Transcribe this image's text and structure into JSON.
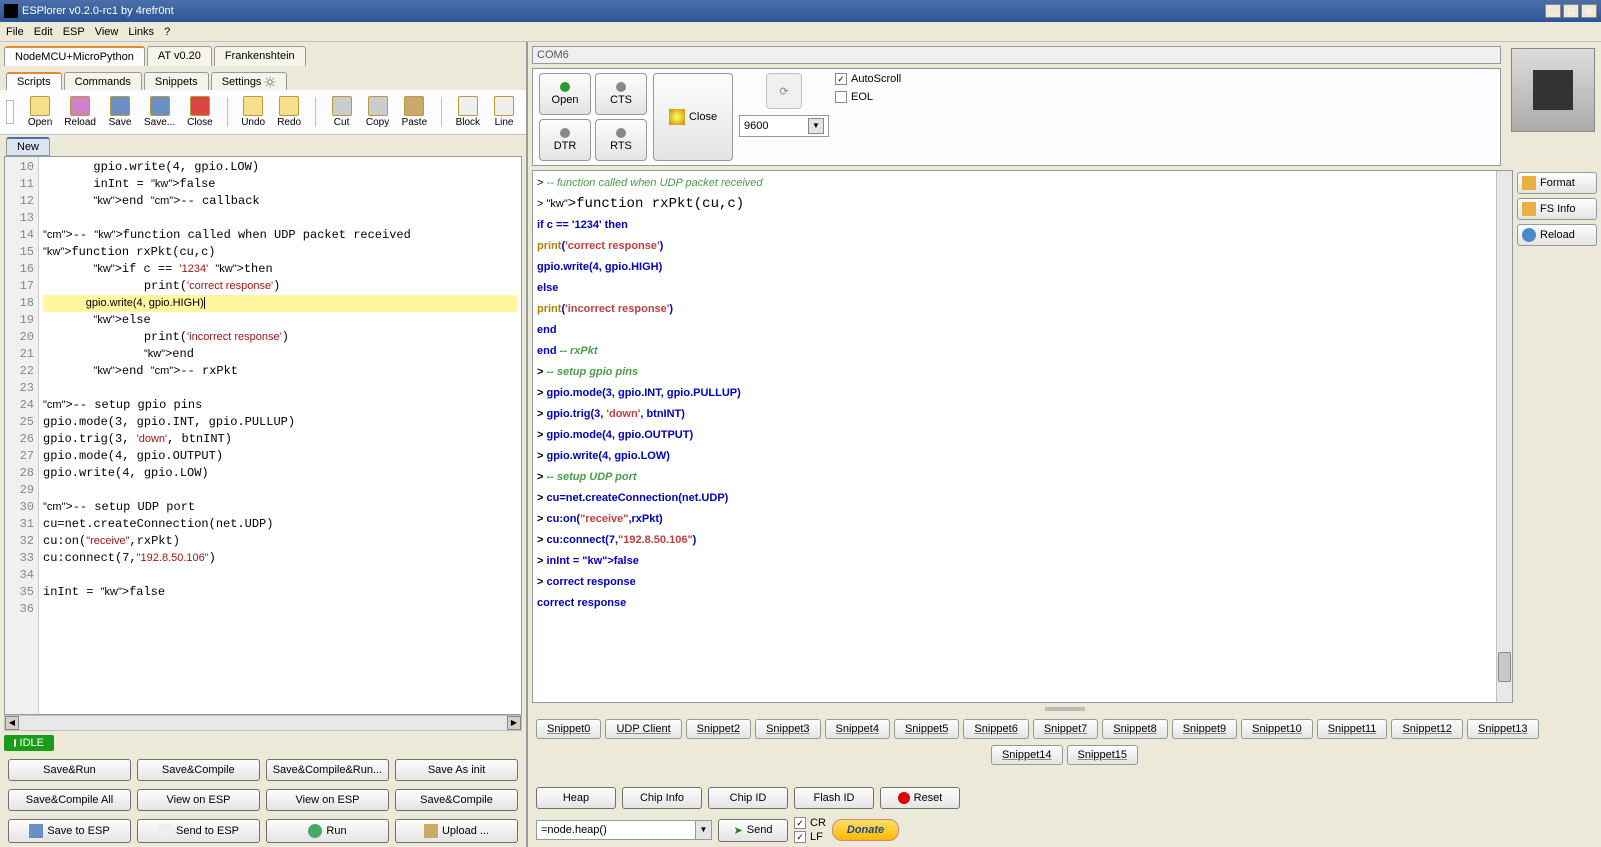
{
  "title": "ESPlorer v0.2.0-rc1 by 4refr0nt",
  "menubar": [
    "File",
    "Edit",
    "ESP",
    "View",
    "Links",
    "?"
  ],
  "left": {
    "top_tabs": [
      "NodeMCU+MicroPython",
      "AT v0.20",
      "Frankenshtein"
    ],
    "sub_tabs": [
      "Scripts",
      "Commands",
      "Snippets",
      "Settings"
    ],
    "toolbar": [
      "Open",
      "Reload",
      "Save",
      "Save...",
      "Close",
      "Undo",
      "Redo",
      "Cut",
      "Copy",
      "Paste",
      "Block",
      "Line"
    ],
    "file_tab": "New",
    "idle": "IDLE",
    "buttons_row1": [
      "Save&Run",
      "Save&Compile",
      "Save&Compile&Run...",
      "Save As init"
    ],
    "buttons_row2": [
      "Save&Compile All",
      "View on ESP",
      "View on ESP",
      "Save&Compile"
    ],
    "buttons_row3": [
      "Save to ESP",
      "Send to ESP",
      "Run",
      "Upload ..."
    ],
    "code_lines": [
      {
        "n": 10,
        "raw": "       gpio.write(4, gpio.LOW)"
      },
      {
        "n": 11,
        "raw": "       inInt = false"
      },
      {
        "n": 12,
        "raw": "       end -- callback"
      },
      {
        "n": 13,
        "raw": ""
      },
      {
        "n": 14,
        "raw": "-- function called when UDP packet received"
      },
      {
        "n": 15,
        "raw": "function rxPkt(cu,c)"
      },
      {
        "n": 16,
        "raw": "       if c == '1234' then"
      },
      {
        "n": 17,
        "raw": "              print('correct response')"
      },
      {
        "n": 18,
        "raw": "              gpio.write(4, gpio.HIGH)",
        "hl": true
      },
      {
        "n": 19,
        "raw": "       else"
      },
      {
        "n": 20,
        "raw": "              print('incorrect response')"
      },
      {
        "n": 21,
        "raw": "              end"
      },
      {
        "n": 22,
        "raw": "       end -- rxPkt"
      },
      {
        "n": 23,
        "raw": ""
      },
      {
        "n": 24,
        "raw": "-- setup gpio pins"
      },
      {
        "n": 25,
        "raw": "gpio.mode(3, gpio.INT, gpio.PULLUP)"
      },
      {
        "n": 26,
        "raw": "gpio.trig(3, 'down', btnINT)"
      },
      {
        "n": 27,
        "raw": "gpio.mode(4, gpio.OUTPUT)"
      },
      {
        "n": 28,
        "raw": "gpio.write(4, gpio.LOW)"
      },
      {
        "n": 29,
        "raw": ""
      },
      {
        "n": 30,
        "raw": "-- setup UDP port"
      },
      {
        "n": 31,
        "raw": "cu=net.createConnection(net.UDP)"
      },
      {
        "n": 32,
        "raw": "cu:on(\"receive\",rxPkt)"
      },
      {
        "n": 33,
        "raw": "cu:connect(7,\"192.8.50.106\")"
      },
      {
        "n": 34,
        "raw": ""
      },
      {
        "n": 35,
        "raw": "inInt = false"
      },
      {
        "n": 36,
        "raw": ""
      }
    ]
  },
  "right": {
    "com_port": "COM6",
    "open": "Open",
    "cts": "CTS",
    "dtr": "DTR",
    "rts": "RTS",
    "close": "Close",
    "baud": "9600",
    "autoscroll": "AutoScroll",
    "eol": "EOL",
    "side_buttons": [
      "Format",
      "FS Info",
      "Reload"
    ],
    "terminal_lines": [
      "> -- function called when UDP packet received",
      "> function rxPkt(cu,c)",
      "if c == '1234' then",
      "print('correct response')",
      "gpio.write(4, gpio.HIGH)",
      "else",
      "print('incorrect response')",
      "end",
      "end -- rxPkt",
      "> -- setup gpio pins",
      "> gpio.mode(3, gpio.INT, gpio.PULLUP)",
      "> gpio.trig(3, 'down', btnINT)",
      "> gpio.mode(4, gpio.OUTPUT)",
      "> gpio.write(4, gpio.LOW)",
      "> -- setup UDP port",
      "> cu=net.createConnection(net.UDP)",
      "> cu:on(\"receive\",rxPkt)",
      "> cu:connect(7,\"192.8.50.106\")",
      "> inInt = false",
      "> correct response",
      "correct response"
    ],
    "snippets_row1": [
      "Snippet0",
      "UDP Client",
      "Snippet2",
      "Snippet3",
      "Snippet4",
      "Snippet5",
      "Snippet6",
      "Snippet7",
      "Snippet8",
      "Snippet9",
      "Snippet10",
      "Snippet11",
      "Snippet12",
      "Snippet13"
    ],
    "snippets_row2": [
      "Snippet14",
      "Snippet15"
    ],
    "bottom_btns": [
      "Heap",
      "Chip Info",
      "Chip ID",
      "Flash ID",
      "Reset"
    ],
    "send_input": "=node.heap()",
    "send": "Send",
    "cr": "CR",
    "lf": "LF",
    "donate": "Donate"
  }
}
